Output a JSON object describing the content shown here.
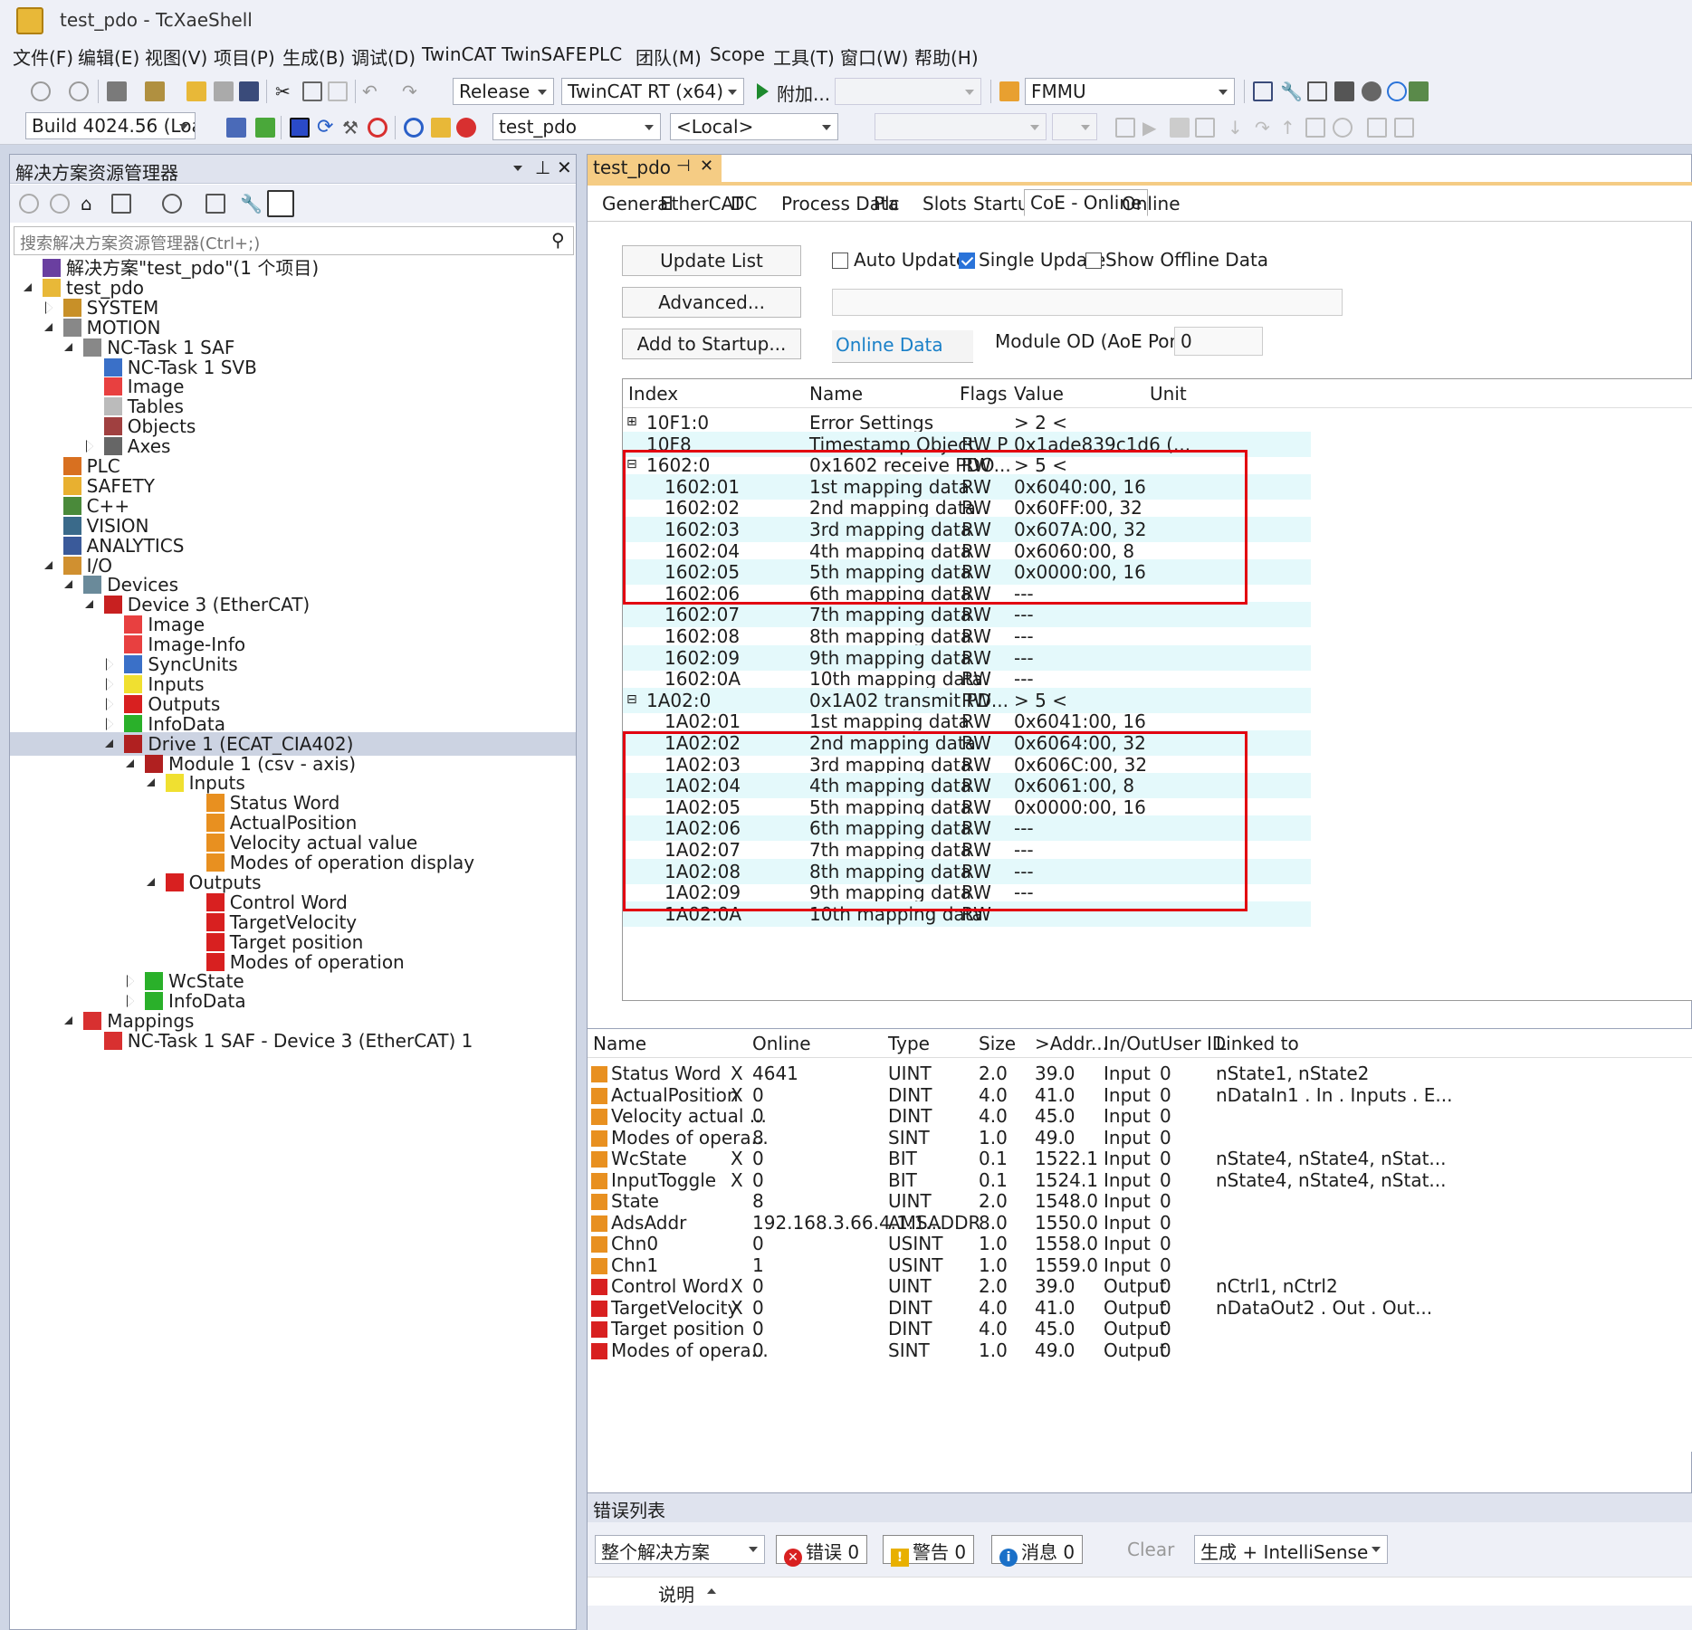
{
  "window": {
    "title": "test_pdo - TcXaeShell"
  },
  "menu": [
    "文件(F)",
    "编辑(E)",
    "视图(V)",
    "项目(P)",
    "生成(B)",
    "调试(D)",
    "TwinCAT",
    "TwinSAFE",
    "PLC",
    "团队(M)",
    "Scope",
    "工具(T)",
    "窗口(W)",
    "帮助(H)"
  ],
  "toolbar": {
    "config": "Release",
    "platform": "TwinCAT RT (x64)",
    "attach": "附加...",
    "fmmu": "FMMU",
    "build": "Build 4024.56 (Loaded",
    "project": "test_pdo",
    "target": "<Local>"
  },
  "solution_explorer": {
    "title": "解决方案资源管理器",
    "search_placeholder": "搜索解决方案资源管理器(Ctrl+;)",
    "nodes": [
      {
        "label": "解决方案\"test_pdo\"(1 个项目)",
        "level": 0,
        "toggle": "none",
        "icon": "solution-icon"
      },
      {
        "label": "test_pdo",
        "level": 0,
        "toggle": "expanded",
        "icon": "project-icon"
      },
      {
        "label": "SYSTEM",
        "level": 1,
        "toggle": "collapsed",
        "icon": "system-icon"
      },
      {
        "label": "MOTION",
        "level": 1,
        "toggle": "expanded",
        "icon": "motion-icon"
      },
      {
        "label": "NC-Task 1 SAF",
        "level": 2,
        "toggle": "expanded",
        "icon": "nc-task-icon"
      },
      {
        "label": "NC-Task 1 SVB",
        "level": 3,
        "toggle": "none",
        "icon": "svb-icon"
      },
      {
        "label": "Image",
        "level": 3,
        "toggle": "none",
        "icon": "image-icon"
      },
      {
        "label": "Tables",
        "level": 3,
        "toggle": "none",
        "icon": "tables-icon"
      },
      {
        "label": "Objects",
        "level": 3,
        "toggle": "none",
        "icon": "objects-icon"
      },
      {
        "label": "Axes",
        "level": 3,
        "toggle": "collapsed",
        "icon": "axes-icon"
      },
      {
        "label": "PLC",
        "level": 1,
        "toggle": "none",
        "icon": "plc-icon"
      },
      {
        "label": "SAFETY",
        "level": 1,
        "toggle": "none",
        "icon": "safety-icon"
      },
      {
        "label": "C++",
        "level": 1,
        "toggle": "none",
        "icon": "cpp-icon"
      },
      {
        "label": "VISION",
        "level": 1,
        "toggle": "none",
        "icon": "vision-icon"
      },
      {
        "label": "ANALYTICS",
        "level": 1,
        "toggle": "none",
        "icon": "analytics-icon"
      },
      {
        "label": "I/O",
        "level": 1,
        "toggle": "expanded",
        "icon": "io-icon"
      },
      {
        "label": "Devices",
        "level": 2,
        "toggle": "expanded",
        "icon": "devices-icon"
      },
      {
        "label": "Device 3 (EtherCAT)",
        "level": 3,
        "toggle": "expanded",
        "icon": "ethercat-device-icon"
      },
      {
        "label": "Image",
        "level": 4,
        "toggle": "none",
        "icon": "image-icon"
      },
      {
        "label": "Image-Info",
        "level": 4,
        "toggle": "none",
        "icon": "image-icon"
      },
      {
        "label": "SyncUnits",
        "level": 4,
        "toggle": "collapsed",
        "icon": "syncunits-icon"
      },
      {
        "label": "Inputs",
        "level": 4,
        "toggle": "collapsed",
        "icon": "inputs-icon"
      },
      {
        "label": "Outputs",
        "level": 4,
        "toggle": "collapsed",
        "icon": "outputs-icon"
      },
      {
        "label": "InfoData",
        "level": 4,
        "toggle": "collapsed",
        "icon": "infodata-icon"
      },
      {
        "label": "Drive 1 (ECAT_CIA402)",
        "level": 4,
        "toggle": "expanded",
        "icon": "drive-icon",
        "selected": true
      },
      {
        "label": "Module 1 (csv -  axis)",
        "level": 5,
        "toggle": "expanded",
        "icon": "module-icon"
      },
      {
        "label": "Inputs",
        "level": 6,
        "toggle": "expanded",
        "icon": "inputs-icon"
      },
      {
        "label": "Status Word",
        "level": 8,
        "toggle": "none",
        "icon": "input-var-icon"
      },
      {
        "label": "ActualPosition",
        "level": 8,
        "toggle": "none",
        "icon": "input-var-icon"
      },
      {
        "label": "Velocity actual value",
        "level": 8,
        "toggle": "none",
        "icon": "input-var-icon"
      },
      {
        "label": "Modes of operation display",
        "level": 8,
        "toggle": "none",
        "icon": "input-var-icon"
      },
      {
        "label": "Outputs",
        "level": 6,
        "toggle": "expanded",
        "icon": "outputs-icon"
      },
      {
        "label": "Control Word",
        "level": 8,
        "toggle": "none",
        "icon": "output-var-icon"
      },
      {
        "label": "TargetVelocity",
        "level": 8,
        "toggle": "none",
        "icon": "output-var-icon"
      },
      {
        "label": "Target position",
        "level": 8,
        "toggle": "none",
        "icon": "output-var-icon"
      },
      {
        "label": "Modes of operation",
        "level": 8,
        "toggle": "none",
        "icon": "output-var-icon"
      },
      {
        "label": "WcState",
        "level": 5,
        "toggle": "collapsed",
        "icon": "infodata-icon"
      },
      {
        "label": "InfoData",
        "level": 5,
        "toggle": "collapsed",
        "icon": "infodata-icon"
      },
      {
        "label": "Mappings",
        "level": 2,
        "toggle": "expanded",
        "icon": "mappings-icon"
      },
      {
        "label": "NC-Task 1 SAF - Device 3 (EtherCAT) 1",
        "level": 3,
        "toggle": "none",
        "icon": "mapping-icon"
      }
    ]
  },
  "document": {
    "tab_title": "test_pdo",
    "tabs": [
      "General",
      "EtherCAT",
      "DC",
      "Process Data",
      "Plc",
      "Slots",
      "Startup",
      "CoE - Online",
      "Online"
    ],
    "active_tab": "CoE - Online",
    "buttons": {
      "update_list": "Update List",
      "advanced": "Advanced...",
      "add_to_startup": "Add to Startup..."
    },
    "checks": {
      "auto_update": "Auto Update",
      "single_update": "Single Update",
      "show_offline": "Show Offline Data"
    },
    "online_data_label": "Online Data",
    "module_od_label": "Module OD (AoE Port):",
    "module_od_value": "0",
    "od_columns": [
      "Index",
      "Name",
      "Flags",
      "Value",
      "Unit"
    ],
    "od_rows": [
      {
        "index": "10F1:0",
        "name": "Error Settings",
        "flags": "",
        "value": "> 2 <",
        "expander": "+",
        "sub": false
      },
      {
        "index": "10F8",
        "name": "Timestamp Object",
        "flags": "RW P",
        "value": "0x1ade839c1d6 (...",
        "expander": "",
        "sub": false
      },
      {
        "index": "1602:0",
        "name": "0x1602 receive PDO...",
        "flags": "RW",
        "value": "> 5 <",
        "expander": "-",
        "sub": false
      },
      {
        "index": "1602:01",
        "name": "1st mapping data",
        "flags": "RW",
        "value": "0x6040:00, 16",
        "sub": true
      },
      {
        "index": "1602:02",
        "name": "2nd mapping data",
        "flags": "RW",
        "value": "0x60FF:00, 32",
        "sub": true
      },
      {
        "index": "1602:03",
        "name": "3rd mapping data",
        "flags": "RW",
        "value": "0x607A:00, 32",
        "sub": true
      },
      {
        "index": "1602:04",
        "name": "4th mapping data",
        "flags": "RW",
        "value": "0x6060:00, 8",
        "sub": true
      },
      {
        "index": "1602:05",
        "name": "5th mapping data",
        "flags": "RW",
        "value": "0x0000:00, 16",
        "sub": true
      },
      {
        "index": "1602:06",
        "name": "6th mapping data",
        "flags": "RW",
        "value": "---",
        "sub": true
      },
      {
        "index": "1602:07",
        "name": "7th mapping data",
        "flags": "RW",
        "value": "---",
        "sub": true
      },
      {
        "index": "1602:08",
        "name": "8th mapping data",
        "flags": "RW",
        "value": "---",
        "sub": true
      },
      {
        "index": "1602:09",
        "name": "9th mapping data",
        "flags": "RW",
        "value": "---",
        "sub": true
      },
      {
        "index": "1602:0A",
        "name": "10th mapping data",
        "flags": "RW",
        "value": "---",
        "sub": true
      },
      {
        "index": "1A02:0",
        "name": "0x1A02 transmit PD...",
        "flags": "RW",
        "value": "> 5 <",
        "expander": "-",
        "sub": false
      },
      {
        "index": "1A02:01",
        "name": "1st mapping data",
        "flags": "RW",
        "value": "0x6041:00, 16",
        "sub": true
      },
      {
        "index": "1A02:02",
        "name": "2nd mapping data",
        "flags": "RW",
        "value": "0x6064:00, 32",
        "sub": true
      },
      {
        "index": "1A02:03",
        "name": "3rd mapping data",
        "flags": "RW",
        "value": "0x606C:00, 32",
        "sub": true
      },
      {
        "index": "1A02:04",
        "name": "4th mapping data",
        "flags": "RW",
        "value": "0x6061:00, 8",
        "sub": true
      },
      {
        "index": "1A02:05",
        "name": "5th mapping data",
        "flags": "RW",
        "value": "0x0000:00, 16",
        "sub": true
      },
      {
        "index": "1A02:06",
        "name": "6th mapping data",
        "flags": "RW",
        "value": "---",
        "sub": true
      },
      {
        "index": "1A02:07",
        "name": "7th mapping data",
        "flags": "RW",
        "value": "---",
        "sub": true
      },
      {
        "index": "1A02:08",
        "name": "8th mapping data",
        "flags": "RW",
        "value": "---",
        "sub": true
      },
      {
        "index": "1A02:09",
        "name": "9th mapping data",
        "flags": "RW",
        "value": "---",
        "sub": true
      },
      {
        "index": "1A02:0A",
        "name": "10th mapping data",
        "flags": "RW",
        "value": "",
        "sub": true
      }
    ]
  },
  "variables": {
    "columns": [
      "Name",
      "Online",
      "Type",
      "Size",
      ">Addr...",
      "In/Out",
      "User ID",
      "Linked to"
    ],
    "rows": [
      {
        "name": "Status Word",
        "x": "X",
        "online": "4641",
        "type": "UINT",
        "size": "2.0",
        "addr": "39.0",
        "io": "Input",
        "uid": "0",
        "linked": "nState1, nState2",
        "dir": "in"
      },
      {
        "name": "ActualPosition",
        "x": "X",
        "online": "0",
        "type": "DINT",
        "size": "4.0",
        "addr": "41.0",
        "io": "Input",
        "uid": "0",
        "linked": "nDataIn1 . In . Inputs . E...",
        "dir": "in"
      },
      {
        "name": "Velocity actual ...",
        "x": "",
        "online": "0",
        "type": "DINT",
        "size": "4.0",
        "addr": "45.0",
        "io": "Input",
        "uid": "0",
        "linked": "",
        "dir": "in"
      },
      {
        "name": "Modes of opera...",
        "x": "",
        "online": "8",
        "type": "SINT",
        "size": "1.0",
        "addr": "49.0",
        "io": "Input",
        "uid": "0",
        "linked": "",
        "dir": "in"
      },
      {
        "name": "WcState",
        "x": "X",
        "online": "0",
        "type": "BIT",
        "size": "0.1",
        "addr": "1522.1",
        "io": "Input",
        "uid": "0",
        "linked": "nState4, nState4, nStat...",
        "dir": "in"
      },
      {
        "name": "InputToggle",
        "x": "X",
        "online": "0",
        "type": "BIT",
        "size": "0.1",
        "addr": "1524.1",
        "io": "Input",
        "uid": "0",
        "linked": "nState4, nState4, nStat...",
        "dir": "in"
      },
      {
        "name": "State",
        "x": "",
        "online": "8",
        "type": "UINT",
        "size": "2.0",
        "addr": "1548.0",
        "io": "Input",
        "uid": "0",
        "linked": "",
        "dir": "in"
      },
      {
        "name": "AdsAddr",
        "x": "",
        "online": "192.168.3.66.4.1:1...",
        "type": "AMSADDR",
        "size": "8.0",
        "addr": "1550.0",
        "io": "Input",
        "uid": "0",
        "linked": "",
        "dir": "in"
      },
      {
        "name": "Chn0",
        "x": "",
        "online": "0",
        "type": "USINT",
        "size": "1.0",
        "addr": "1558.0",
        "io": "Input",
        "uid": "0",
        "linked": "",
        "dir": "in"
      },
      {
        "name": "Chn1",
        "x": "",
        "online": "1",
        "type": "USINT",
        "size": "1.0",
        "addr": "1559.0",
        "io": "Input",
        "uid": "0",
        "linked": "",
        "dir": "in"
      },
      {
        "name": "Control Word",
        "x": "X",
        "online": "0",
        "type": "UINT",
        "size": "2.0",
        "addr": "39.0",
        "io": "Output",
        "uid": "0",
        "linked": "nCtrl1, nCtrl2",
        "dir": "out"
      },
      {
        "name": "TargetVelocity",
        "x": "X",
        "online": "0",
        "type": "DINT",
        "size": "4.0",
        "addr": "41.0",
        "io": "Output",
        "uid": "0",
        "linked": "nDataOut2 . Out . Out...",
        "dir": "out"
      },
      {
        "name": "Target position",
        "x": "",
        "online": "0",
        "type": "DINT",
        "size": "4.0",
        "addr": "45.0",
        "io": "Output",
        "uid": "0",
        "linked": "",
        "dir": "out"
      },
      {
        "name": "Modes of opera...",
        "x": "",
        "online": "0",
        "type": "SINT",
        "size": "1.0",
        "addr": "49.0",
        "io": "Output",
        "uid": "0",
        "linked": "",
        "dir": "out"
      }
    ]
  },
  "error_list": {
    "title": "错误列表",
    "scope": "整个解决方案",
    "errors": "错误 0",
    "warnings": "警告 0",
    "messages": "消息 0",
    "clear": "Clear",
    "build_filter": "生成 + IntelliSense",
    "desc_col": "说明"
  },
  "colors": {
    "accent_tab": "#f5cc84",
    "highlight_box": "#e20010",
    "row_alt": "#e4f9fb",
    "selected": "#ccd3e2"
  }
}
